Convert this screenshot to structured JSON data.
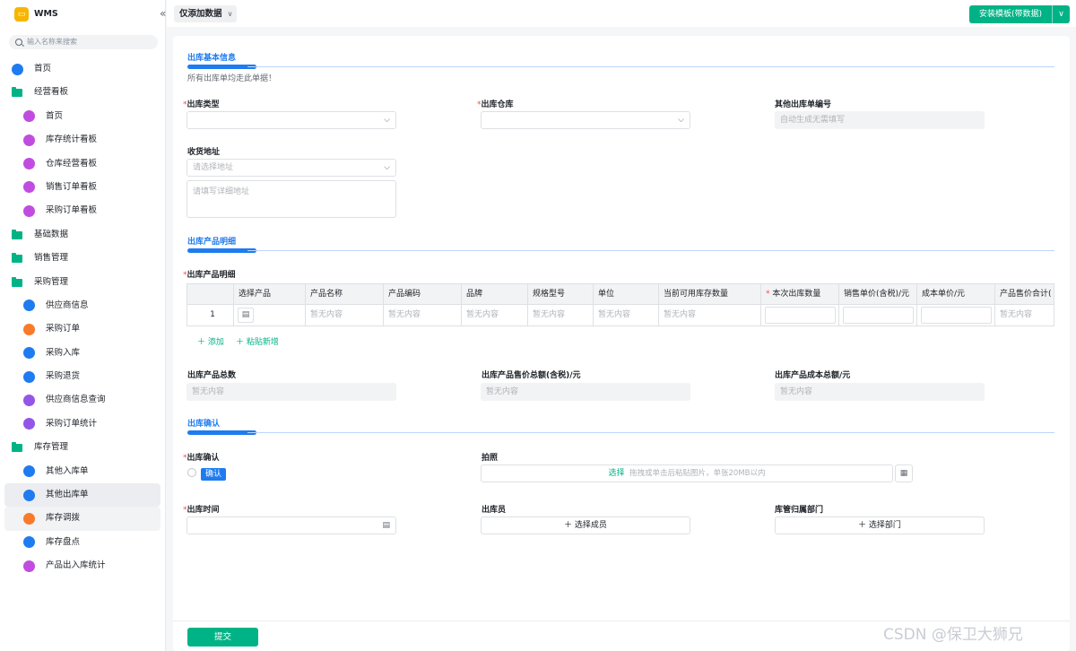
{
  "app": {
    "name": "WMS",
    "collapse_icon": "«"
  },
  "sidebar": {
    "search_placeholder": "输入名称来搜索",
    "items": [
      {
        "label": "首页",
        "type": "home",
        "level": 0
      },
      {
        "label": "经营看板",
        "type": "folder",
        "level": 0
      },
      {
        "label": "首页",
        "type": "board",
        "color": "#c04de0",
        "level": 1
      },
      {
        "label": "库存统计看板",
        "type": "board",
        "color": "#c04de0",
        "level": 1
      },
      {
        "label": "仓库经营看板",
        "type": "board",
        "color": "#c04de0",
        "level": 1
      },
      {
        "label": "销售订单看板",
        "type": "board",
        "color": "#c04de0",
        "level": 1
      },
      {
        "label": "采购订单看板",
        "type": "board",
        "color": "#c04de0",
        "level": 1
      },
      {
        "label": "基础数据",
        "type": "folder",
        "level": 0
      },
      {
        "label": "销售管理",
        "type": "folder",
        "level": 0
      },
      {
        "label": "采购管理",
        "type": "folder",
        "level": 0
      },
      {
        "label": "供应商信息",
        "type": "user",
        "color": "#1f7bf0",
        "level": 1
      },
      {
        "label": "采购订单",
        "type": "form",
        "color": "#f77b2a",
        "level": 1
      },
      {
        "label": "采购入库",
        "type": "form",
        "color": "#1f7bf0",
        "level": 1
      },
      {
        "label": "采购退货",
        "type": "form",
        "color": "#1f7bf0",
        "level": 1
      },
      {
        "label": "供应商信息查询",
        "type": "chart",
        "color": "#9456e8",
        "level": 1
      },
      {
        "label": "采购订单统计",
        "type": "chart",
        "color": "#9456e8",
        "level": 1
      },
      {
        "label": "库存管理",
        "type": "folder",
        "level": 0
      },
      {
        "label": "其他入库单",
        "type": "form",
        "color": "#1f7bf0",
        "level": 1
      },
      {
        "label": "其他出库单",
        "type": "form",
        "color": "#1f7bf0",
        "level": 1,
        "selected": true
      },
      {
        "label": "库存调拨",
        "type": "form",
        "color": "#f77b2a",
        "level": 1,
        "hover": true
      },
      {
        "label": "库存盘点",
        "type": "form",
        "color": "#1f7bf0",
        "level": 1
      },
      {
        "label": "产品出入库统计",
        "type": "board",
        "color": "#c04de0",
        "level": 1
      }
    ]
  },
  "topbar": {
    "view_label": "仅添加数据",
    "install_label": "安装模板(带数据)"
  },
  "form": {
    "section1": {
      "title": "出库基本信息",
      "hint": "所有出库单均走此单据！"
    },
    "out_type": {
      "label": "出库类型",
      "value": ""
    },
    "warehouse": {
      "label": "出库仓库",
      "value": ""
    },
    "other_no": {
      "label": "其他出库单编号",
      "placeholder": "自动生成无需填写"
    },
    "address": {
      "label": "收货地址",
      "placeholder": "请选择地址",
      "detail_placeholder": "请填写详细地址"
    },
    "section2": {
      "title": "出库产品明细"
    },
    "detail_label": "出库产品明细",
    "table": {
      "columns": [
        "",
        "选择产品",
        "产品名称",
        "产品编码",
        "品牌",
        "规格型号",
        "单位",
        "当前可用库存数量",
        "本次出库数量",
        "销售单价(含税)/元",
        "成本单价/元",
        "产品售价合计("
      ],
      "row": {
        "index": "1",
        "empty": "暂无内容"
      }
    },
    "add_label": "添加",
    "paste_label": "粘贴新增",
    "total_qty": {
      "label": "出库产品总数",
      "value": "暂无内容"
    },
    "total_price": {
      "label": "出库产品售价总额(含税)/元",
      "value": "暂无内容"
    },
    "total_cost": {
      "label": "出库产品成本总额/元",
      "value": "暂无内容"
    },
    "section3": {
      "title": "出库确认"
    },
    "confirm": {
      "label": "出库确认",
      "option": "确认"
    },
    "photo": {
      "label": "拍照",
      "pick": "选择",
      "hint": "拖拽或单击后粘贴图片，单张20MB以内"
    },
    "out_time": {
      "label": "出库时间"
    },
    "operator": {
      "label": "出库员",
      "button": "选择成员"
    },
    "dept": {
      "label": "库管归属部门",
      "button": "选择部门"
    },
    "submit": "提交"
  },
  "watermark": "CSDN @保卫大狮兄"
}
